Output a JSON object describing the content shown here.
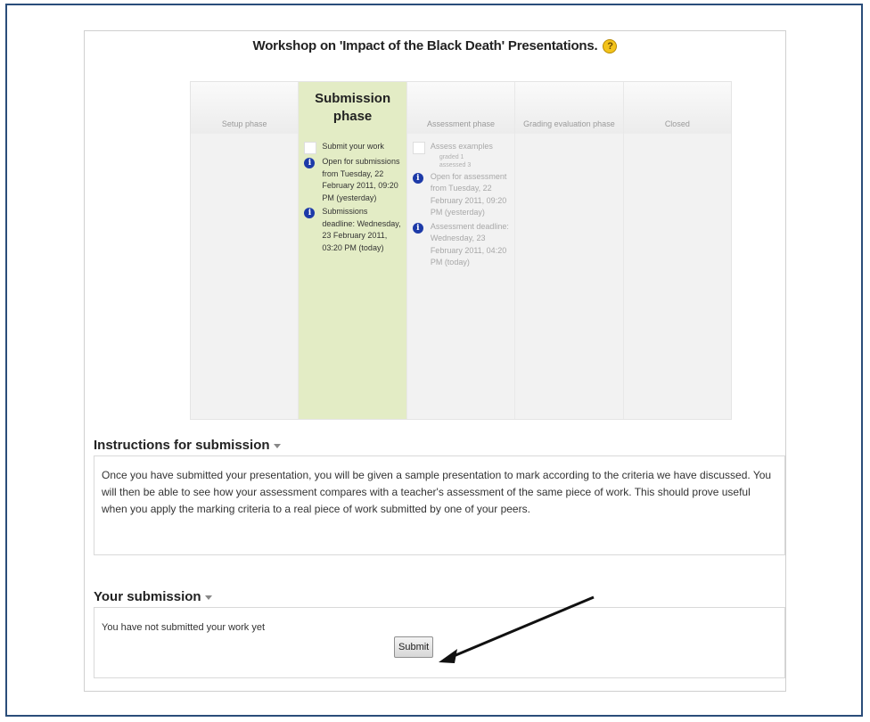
{
  "workshop": {
    "title": "Workshop on 'Impact of the Black Death' Presentations.",
    "help_icon": "question-mark-help-icon"
  },
  "phases": [
    {
      "name": "Setup phase",
      "active": false,
      "tasks": []
    },
    {
      "name": "Submission phase",
      "active": true,
      "tasks": [
        {
          "type": "checkbox",
          "text": "Submit your work"
        },
        {
          "type": "info",
          "text": "Open for submissions from Tuesday, 22 February 2011, 09:20 PM (yesterday)"
        },
        {
          "type": "info",
          "text": "Submissions deadline: Wednesday, 23 February 2011, 03:20 PM (today)"
        }
      ]
    },
    {
      "name": "Assessment phase",
      "active": false,
      "tasks": [
        {
          "type": "checkbox",
          "text": "Assess examples",
          "sub": [
            "graded 1",
            "assessed 3"
          ]
        },
        {
          "type": "info",
          "text": "Open for assessment from Tuesday, 22 February 2011, 09:20 PM (yesterday)"
        },
        {
          "type": "info",
          "text": "Assessment deadline: Wednesday, 23 February 2011, 04:20 PM (today)"
        }
      ]
    },
    {
      "name": "Grading evaluation phase",
      "active": false,
      "tasks": []
    },
    {
      "name": "Closed",
      "active": false,
      "tasks": []
    }
  ],
  "instructions": {
    "heading": "Instructions for submission",
    "text": "Once you have submitted your presentation, you will be given a sample presentation to mark according to the criteria we have discussed. You will then be able to see how your assessment compares with a teacher's assessment of the same piece of work. This should prove useful when you apply the marking criteria to a real piece of work submitted by one of your peers."
  },
  "submission": {
    "heading": "Your submission",
    "status": "You have not submitted your work yet",
    "submit_label": "Submit"
  },
  "colors": {
    "frame_border": "#2a4d7a",
    "active_phase": "#e3ecc5",
    "info_icon": "#1d3aa8",
    "help_icon": "#f3c31b"
  }
}
